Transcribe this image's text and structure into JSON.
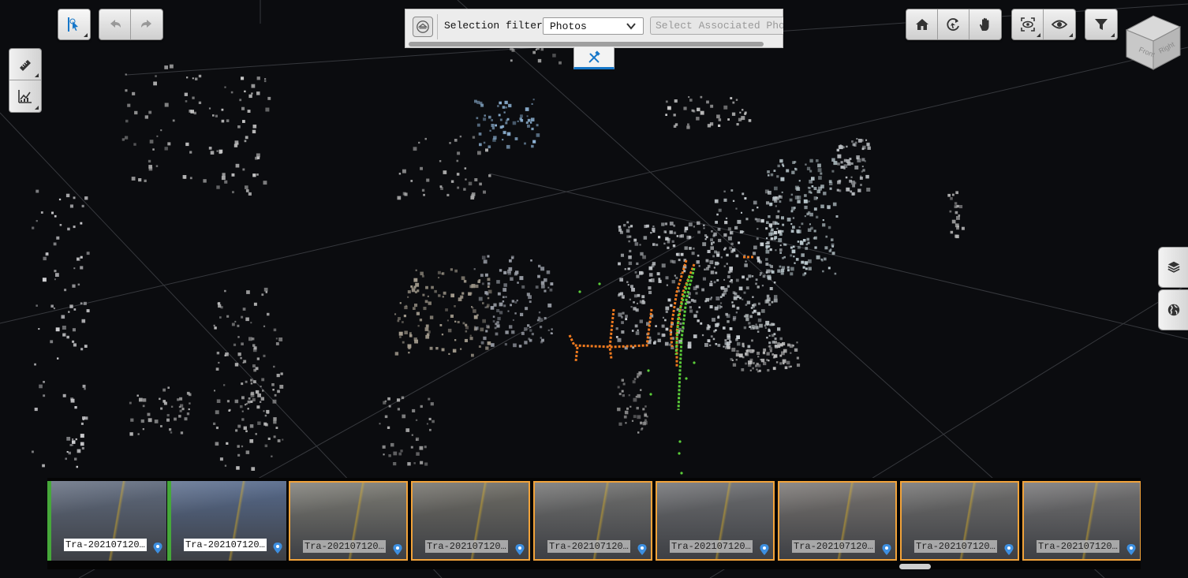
{
  "toolbar": {
    "select_tool": "select-tool",
    "undo": "undo",
    "redo": "redo",
    "measure": "measure-tool",
    "profile": "profile-tool"
  },
  "selection_filter": {
    "label": "Selection filter:",
    "value": "Photos",
    "associated_placeholder": "Select Associated Photos"
  },
  "view_controls": {
    "home": "home",
    "orbit": "orbit",
    "pan": "pan",
    "focus": "focus",
    "visibility": "visibility",
    "filter": "filter"
  },
  "view_cube": {
    "front": "Front",
    "right": "Right"
  },
  "side_panel": {
    "layers": "layers",
    "globe": "globe"
  },
  "photos": [
    {
      "caption": "Tra-202107120…",
      "state": "loaded",
      "tone": "#5f6a7d"
    },
    {
      "caption": "Tra-202107120…",
      "state": "loaded",
      "tone": "#566a8c"
    },
    {
      "caption": "Tra-202107120…",
      "state": "selected",
      "tone": "#7b7a72"
    },
    {
      "caption": "Tra-202107120…",
      "state": "selected",
      "tone": "#6e6c64"
    },
    {
      "caption": "Tra-202107120…",
      "state": "selected",
      "tone": "#6f6f6d"
    },
    {
      "caption": "Tra-202107120…",
      "state": "selected",
      "tone": "#6b6c6e"
    },
    {
      "caption": "Tra-202107120…",
      "state": "selected",
      "tone": "#77736f"
    },
    {
      "caption": "Tra-202107120…",
      "state": "selected",
      "tone": "#6f6e6c"
    },
    {
      "caption": "Tra-202107120…",
      "state": "selected",
      "tone": "#727171"
    }
  ],
  "colors": {
    "accent": "#1677c9",
    "selected_border": "#f2a33a",
    "loaded_marker": "#46a83a",
    "trajectory_orange": "#f07a1e",
    "trajectory_green": "#5ccf3a"
  }
}
